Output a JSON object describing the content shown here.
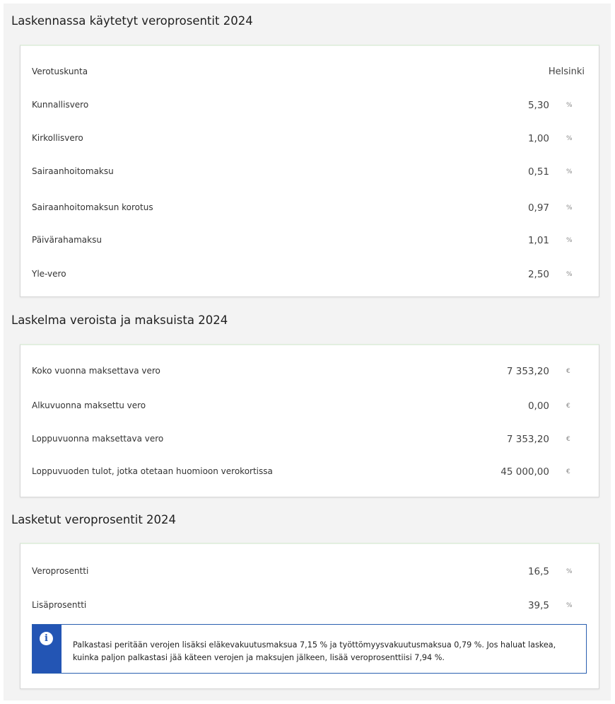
{
  "section1": {
    "title": "Laskennassa käytetyt veroprosentit 2024",
    "rows": [
      {
        "label": "Verotuskunta",
        "value": "Helsinki",
        "unit": ""
      },
      {
        "label": "Kunnallisvero",
        "value": "5,30",
        "unit": "%"
      },
      {
        "label": "Kirkollisvero",
        "value": "1,00",
        "unit": "%"
      },
      {
        "label": "Sairaanhoitomaksu",
        "value": "0,51",
        "unit": "%"
      },
      {
        "label": "Sairaanhoitomaksun korotus",
        "value": "0,97",
        "unit": "%"
      },
      {
        "label": "Päivärahamaksu",
        "value": "1,01",
        "unit": "%"
      },
      {
        "label": "Yle-vero",
        "value": "2,50",
        "unit": "%"
      }
    ]
  },
  "section2": {
    "title": "Laskelma veroista ja maksuista 2024",
    "rows": [
      {
        "label": "Koko vuonna maksettava vero",
        "value": "7 353,20",
        "unit": "€"
      },
      {
        "label": "Alkuvuonna maksettu vero",
        "value": "0,00",
        "unit": "€"
      },
      {
        "label": "Loppuvuonna maksettava vero",
        "value": "7 353,20",
        "unit": "€"
      },
      {
        "label": "Loppuvuoden tulot, jotka otetaan huomioon verokortissa",
        "value": "45 000,00",
        "unit": "€"
      }
    ]
  },
  "section3": {
    "title": "Lasketut veroprosentit 2024",
    "rows": [
      {
        "label": "Veroprosentti",
        "value": "16,5",
        "unit": "%"
      },
      {
        "label": "Lisäprosentti",
        "value": "39,5",
        "unit": "%"
      }
    ],
    "info": {
      "icon": "info-icon",
      "icon_glyph": "i",
      "text": "Palkastasi peritään verojen lisäksi eläkevakuutusmaksua 7,15 % ja työttömyysvakuutusmaksua 0,79 %. Jos haluat laskea, kuinka paljon palkastasi jää käteen verojen ja maksujen jälkeen, lisää veroprosenttiisi 7,94 %."
    }
  }
}
